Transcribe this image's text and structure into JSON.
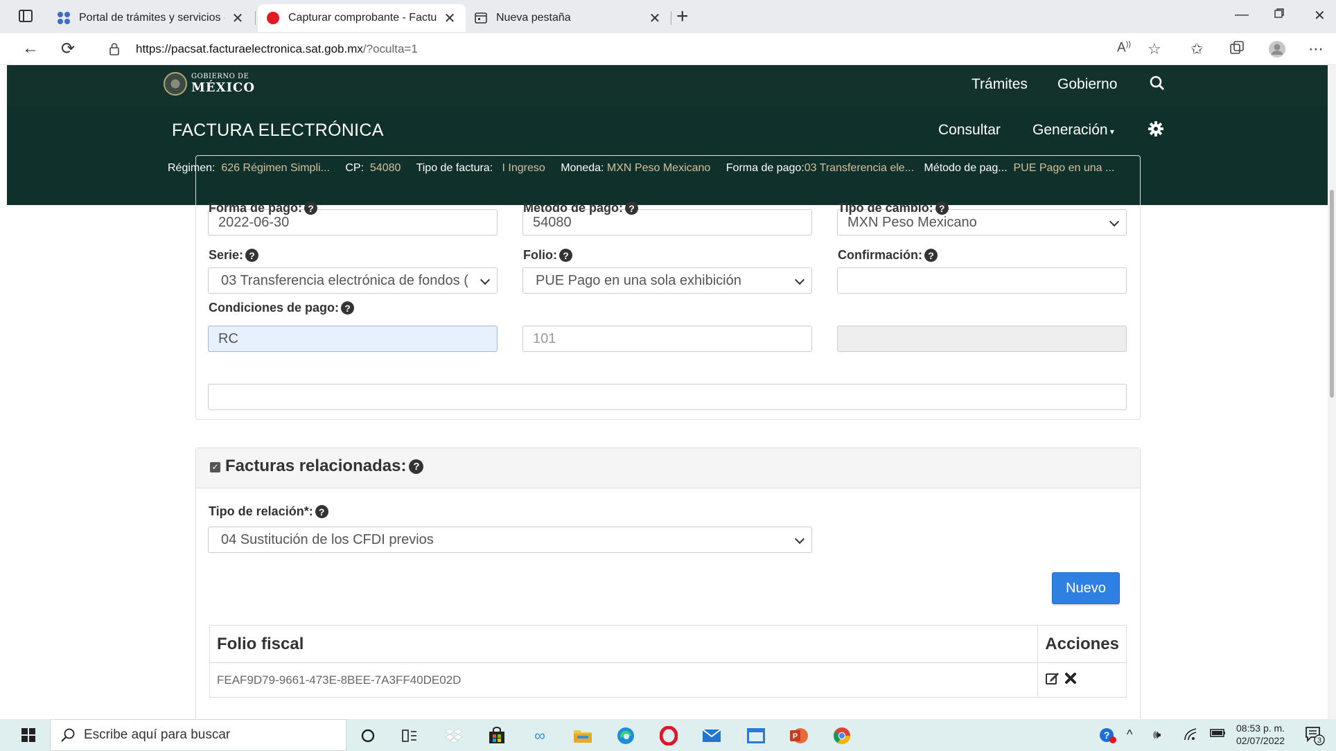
{
  "browser": {
    "tabs": [
      {
        "title": "Portal de trámites y servicios - SAT",
        "active": false
      },
      {
        "title": "Capturar comprobante - Factura Electrónica",
        "active": true
      },
      {
        "title": "Nueva pestaña",
        "active": false
      }
    ],
    "url_host": "https://pacsat.facturaelectronica.sat.gob.mx",
    "url_rest": "/?oculta=1"
  },
  "gov": {
    "logo_small": "GOBIERNO DE",
    "logo_big": "MÉXICO",
    "links": [
      "Trámites",
      "Gobierno"
    ]
  },
  "app": {
    "title": "FACTURA ELECTRÓNICA",
    "nav": [
      "Consultar",
      "Generación"
    ],
    "summary": {
      "regimen_label": "Régimen:",
      "regimen_value": "626 Régimen Simpli...",
      "cp_label": "CP:",
      "cp_value": "54080",
      "tipo_label": "Tipo de factura:",
      "tipo_value": "I Ingreso",
      "moneda_label": "Moneda:",
      "moneda_value": "MXN Peso Mexicano",
      "forma_label": "Forma de pago:",
      "forma_value": "03 Transferencia ele...",
      "metodo_label": "Método de pag...",
      "metodo_value": "PUE Pago en una ..."
    }
  },
  "form": {
    "fecha": "2022-06-30",
    "cp": "54080",
    "moneda": "MXN Peso Mexicano",
    "forma_pago_label": "Forma de pago:",
    "forma_pago": "03 Transferencia electrónica de fondos (",
    "metodo_pago_label": "Método de pago:",
    "metodo_pago": "PUE Pago en una sola exhibición",
    "tipo_cambio_label": "Tipo de cambio:",
    "tipo_cambio": "",
    "serie_label": "Serie:",
    "serie": "RC",
    "folio_label": "Folio:",
    "folio_placeholder": "101",
    "confirmacion_label": "Confirmación:",
    "condiciones_label": "Condiciones de pago:",
    "condiciones": ""
  },
  "relacionadas": {
    "title": "Facturas relacionadas:",
    "tipo_relacion_label": "Tipo de relación*:",
    "tipo_relacion": "04 Sustitución de los CFDI previos",
    "nuevo_label": "Nuevo",
    "table": {
      "headers": [
        "Folio fiscal",
        "Acciones"
      ],
      "rows": [
        [
          "FEAF9D79-9661-473E-8BEE-7A3FF40DE02D"
        ]
      ]
    }
  },
  "taskbar": {
    "search_placeholder": "Escribe aquí para buscar",
    "time": "08:53 p. m.",
    "date": "02/07/2022",
    "notifications": "3"
  }
}
